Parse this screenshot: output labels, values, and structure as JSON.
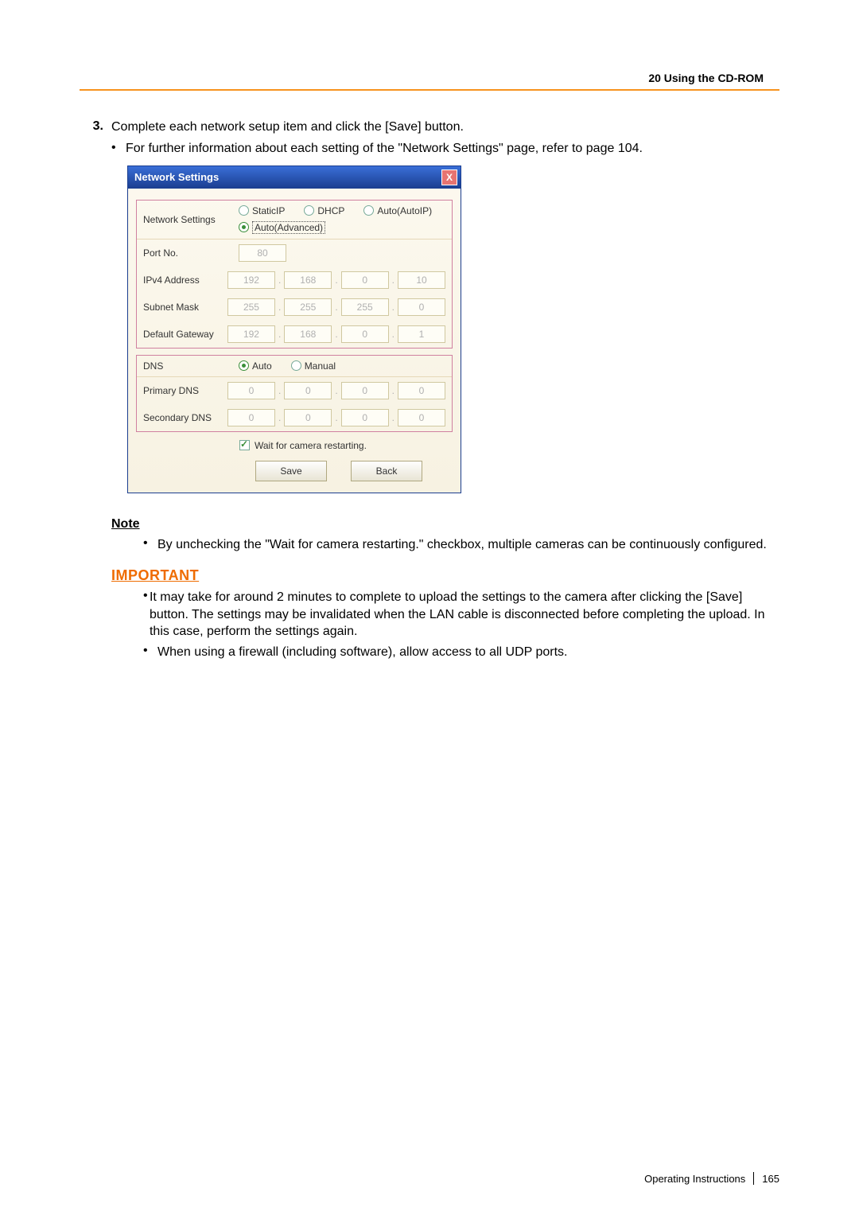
{
  "header": {
    "section": "20 Using the CD-ROM"
  },
  "step": {
    "num": "3.",
    "text": "Complete each network setup item and click the [Save] button.",
    "sub": "For further information about each setting of the \"Network Settings\" page, refer to page 104."
  },
  "dialog": {
    "title": "Network Settings",
    "close_glyph": "X",
    "rows": {
      "network_settings_label": "Network Settings",
      "options": {
        "static_ip": "StaticIP",
        "dhcp": "DHCP",
        "auto_ip": "Auto(AutoIP)",
        "auto_advanced": "Auto(Advanced)"
      },
      "port_label": "Port No.",
      "port_value": "80",
      "ipv4_label": "IPv4 Address",
      "ipv4": [
        "192",
        "168",
        "0",
        "10"
      ],
      "subnet_label": "Subnet Mask",
      "subnet": [
        "255",
        "255",
        "255",
        "0"
      ],
      "gateway_label": "Default Gateway",
      "gateway": [
        "192",
        "168",
        "0",
        "1"
      ],
      "dns_label": "DNS",
      "dns_auto": "Auto",
      "dns_manual": "Manual",
      "primary_label": "Primary DNS",
      "primary": [
        "0",
        "0",
        "0",
        "0"
      ],
      "secondary_label": "Secondary DNS",
      "secondary": [
        "0",
        "0",
        "0",
        "0"
      ]
    },
    "wait_label": "Wait for camera restarting.",
    "buttons": {
      "save": "Save",
      "back": "Back"
    }
  },
  "note": {
    "heading": "Note",
    "items": [
      "By unchecking the \"Wait for camera restarting.\" checkbox, multiple cameras can be continuously configured."
    ]
  },
  "important": {
    "heading": "IMPORTANT",
    "items": [
      "It may take for around 2 minutes to complete to upload the settings to the camera after clicking the [Save] button. The settings may be invalidated when the LAN cable is disconnected before completing the upload. In this case, perform the settings again.",
      "When using a firewall (including software), allow access to all UDP ports."
    ]
  },
  "footer": {
    "label": "Operating Instructions",
    "page": "165"
  }
}
